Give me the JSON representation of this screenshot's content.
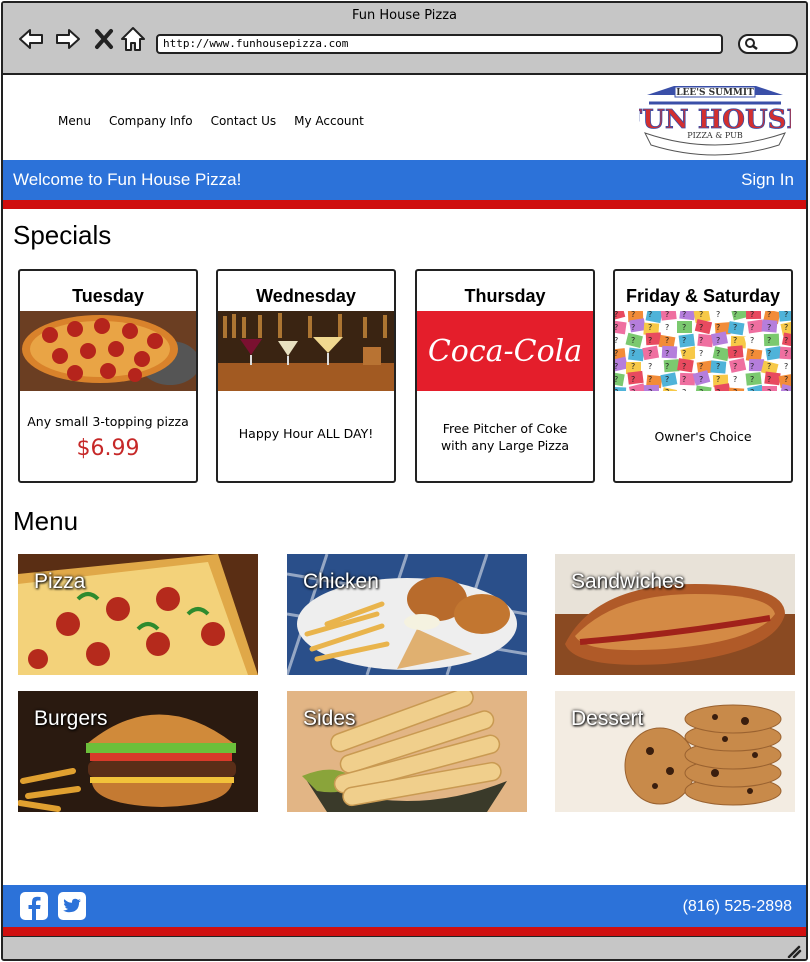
{
  "browser": {
    "title": "Fun House Pizza",
    "url": "http://www.funhousepizza.com"
  },
  "nav": {
    "items": [
      "Menu",
      "Company Info",
      "Contact Us",
      "My Account"
    ]
  },
  "logo": {
    "text_top": "LEE'S SUMMIT",
    "text_main": "FUN HOUSE",
    "text_sub": "PIZZA & PUB"
  },
  "welcome": {
    "message": "Welcome to Fun House Pizza!",
    "signin": "Sign In"
  },
  "specials": {
    "title": "Specials",
    "items": [
      {
        "day": "Tuesday",
        "desc": "Any small 3-topping pizza",
        "price": "$6.99"
      },
      {
        "day": "Wednesday",
        "desc": "Happy Hour ALL DAY!"
      },
      {
        "day": "Thursday",
        "desc_line1": "Free Pitcher of Coke",
        "desc_line2": "with any Large Pizza",
        "brand": "Coca-Cola"
      },
      {
        "day": "Friday & Saturday",
        "desc": "Owner's Choice"
      }
    ]
  },
  "menu": {
    "title": "Menu",
    "items": [
      "Pizza",
      "Chicken",
      "Sandwiches",
      "Burgers",
      "Sides",
      "Dessert"
    ]
  },
  "footer": {
    "phone": "(816) 525-2898"
  },
  "colors": {
    "blue": "#2c72d9",
    "red": "#cf0f0f",
    "chrome": "#c6c6c6"
  }
}
